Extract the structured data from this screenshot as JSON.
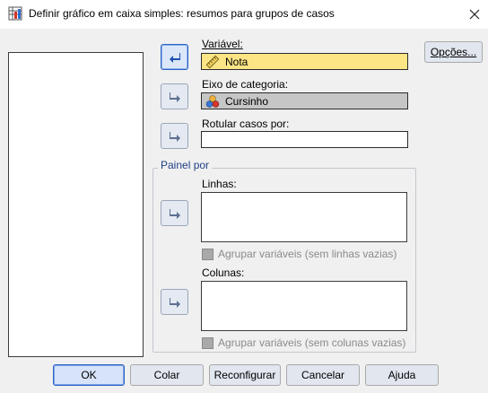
{
  "window": {
    "title": "Definir gráfico em caixa simples: resumos para grupos de casos",
    "close_icon": "close-icon",
    "app_icon": "chart-app-icon"
  },
  "fields": {
    "variable": {
      "label": "Variável:",
      "value": "Nota",
      "icon": "ruler-scale-icon"
    },
    "category_axis": {
      "label": "Eixo de categoria:",
      "value": "Cursinho",
      "icon": "nominal-variable-icon"
    },
    "label_cases": {
      "label": "Rotular casos por:",
      "value": ""
    }
  },
  "panel": {
    "legend": "Painel por",
    "rows_label": "Linhas:",
    "rows_nest": "Agrupar variáveis (sem linhas vazias)",
    "columns_label": "Colunas:",
    "columns_nest": "Agrupar variáveis (sem colunas vazias)"
  },
  "buttons": {
    "options": "Opções...",
    "ok": "OK",
    "paste": "Colar",
    "reset": "Reconfigurar",
    "cancel": "Cancelar",
    "help": "Ajuda"
  },
  "colors": {
    "variable_field": "#fbe585",
    "category_field": "#c6c6c6",
    "legend_text": "#1f3f86",
    "default_button_border": "#2b62c6"
  }
}
